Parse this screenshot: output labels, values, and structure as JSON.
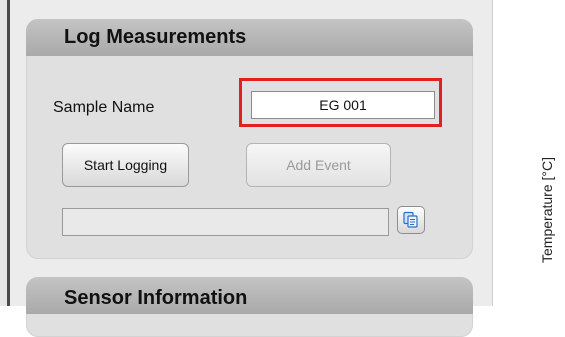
{
  "log_measurements": {
    "title": "Log Measurements",
    "sample_name_label": "Sample Name",
    "sample_name_value": "EG 001",
    "start_logging_label": "Start Logging",
    "add_event_label": "Add Event",
    "file_path_value": ""
  },
  "sensor_information": {
    "title": "Sensor Information"
  },
  "plot": {
    "y_axis_label": "Temperature [°C]"
  },
  "colors": {
    "highlight": "#e32020",
    "header": "#b8b8b8",
    "icon_accent": "#2b6fc2"
  },
  "icons": {
    "file_button": "copy-icon"
  }
}
